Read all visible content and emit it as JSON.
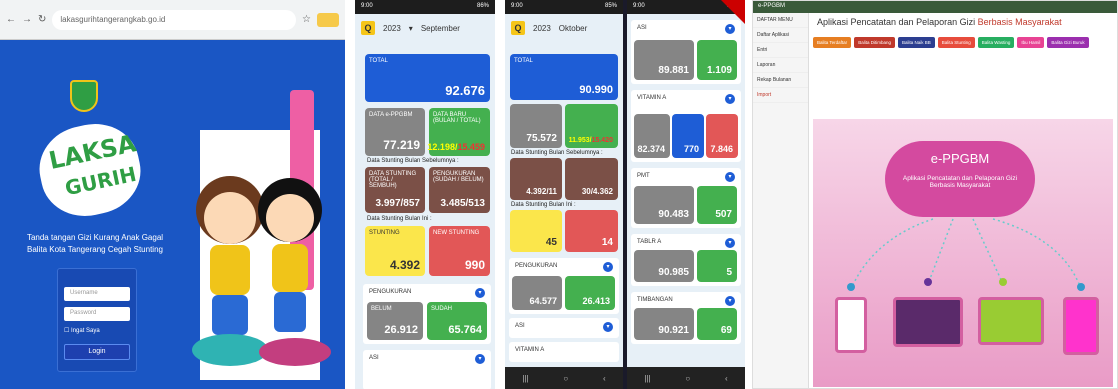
{
  "login": {
    "url": "lakasgurihtangerangkab.go.id",
    "tagline": "Tanda tangan Gizi Kurang Anak Gagal Balita Kota Tangerang Cegah Stunting",
    "user_placeholder": "Username",
    "pass_placeholder": "Password",
    "remember": "Ingat Saya",
    "login_btn": "Login",
    "logo_a": "LAKSA",
    "logo_b": "GURIH"
  },
  "phone1": {
    "year": "2023",
    "month": "September",
    "total_label": "TOTAL",
    "total": "92.676",
    "eppgbm_label": "DATA e-PPGBM",
    "eppgbm": "77.219",
    "baru_label": "DATA BARU (BULAN / TOTAL)",
    "baru_a": "12.198",
    "baru_b": "15.459",
    "sebelum": "Data Stunting Bulan Sebelumnya :",
    "st_label": "DATA STUNTING (TOTAL / SEMBUH)",
    "st_val": "3.997/857",
    "peng_label": "PENGUKURAN (SUDAH / BELUM)",
    "peng_val": "3.485/513",
    "ini": "Data Stunting Bulan Ini :",
    "stunting_label": "STUNTING",
    "stunting": "4.392",
    "new_label": "NEW STUNTING",
    "new_val": "990",
    "pengukuran": "PENGUKURAN",
    "belum_label": "BELUM",
    "belum": "26.912",
    "sudah_label": "SUDAH",
    "sudah": "65.764",
    "asi": "ASI"
  },
  "phone2": {
    "year": "2023",
    "month": "Oktober",
    "total": "90.990",
    "eppgbm": "75.572",
    "baru_a": "11.953",
    "baru_b": "15.420",
    "sebelum": "Data Stunting Bulan Sebelumnya :",
    "st_val": "4.392/11",
    "peng_val": "30/4.362",
    "ini": "Data Stunting Bulan Ini :",
    "stunting": "45",
    "new_val": "14",
    "pengukuran": "PENGUKURAN",
    "belum": "64.577",
    "sudah": "26.413",
    "asi": "ASI",
    "vit": "VITAMIN A"
  },
  "phone3": {
    "asi": "ASI",
    "asi_belum": "89.881",
    "asi_sudah": "1.109",
    "vit": "VITAMIN A",
    "vit_belum": "82.374",
    "vit_sudah": "770",
    "vit_sudah2": "7.846",
    "pmt": "PMT",
    "pmt_belum": "90.483",
    "pmt_sudah": "507",
    "tablet": "TABLR A",
    "tab_belum": "90.985",
    "tab_sudah": "5",
    "timbang": "TIMBANGAN",
    "tim_belum": "90.921",
    "tim_sudah": "69"
  },
  "web": {
    "brand": "e-PPGBM",
    "title_a": "Aplikasi Pencatatan dan Pelaporan Gizi ",
    "title_b": "Berbasis Masyarakat",
    "menu": [
      "DAFTAR MENU",
      "Daftar Aplikasi",
      "Entri",
      "Laporan",
      "Rekap Bulanan",
      "Import"
    ],
    "chips": [
      "Balita Terdaftar",
      "Balita Ditimbang",
      "Balita Naik BB",
      "Balita Stunting",
      "Balita Wasting",
      "Ibu Hamil",
      "Balita Gizi Buruk"
    ],
    "cloud_title": "e-PPGBM",
    "cloud_sub": "Aplikasi Pencatatan dan Pelaporan Gizi Berbasis Masyarakat"
  }
}
